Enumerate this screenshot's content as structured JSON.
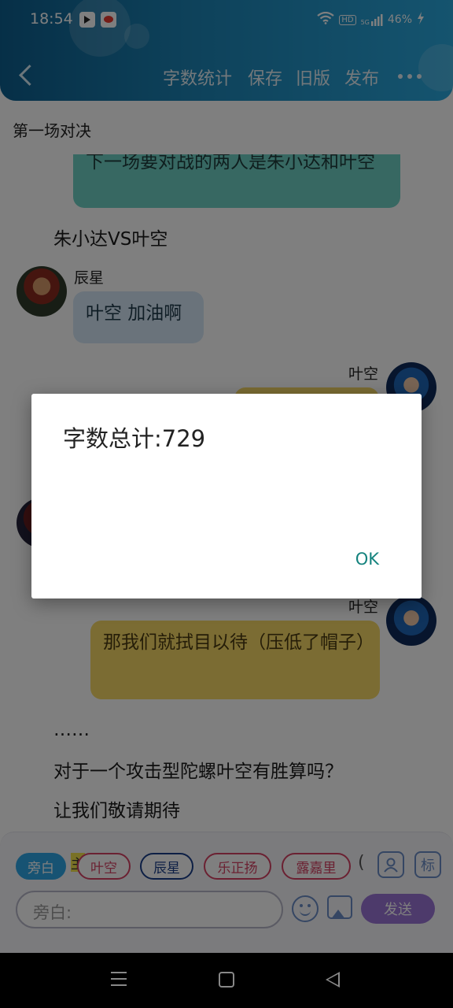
{
  "status_bar": {
    "time": "18:54",
    "network": "5G",
    "hd_label": "HD",
    "battery": "46%"
  },
  "header": {
    "nav": [
      "字数统计",
      "保存",
      "旧版",
      "发布"
    ]
  },
  "scene": {
    "title": "第一场对决"
  },
  "chat": {
    "top_bubble": "下一场要对战的两人是朱小达和叶空",
    "narration_1": "朱小达VS叶空",
    "msg_chenxing": {
      "name": "辰星",
      "text": "叶空 加油啊"
    },
    "msg_yekong_1": {
      "name": "叶空"
    },
    "msg_yekong_2": {
      "name": "叶空",
      "text": "那我们就拭目以待（压低了帽子）"
    },
    "narration_2": "……",
    "narration_3": "对于一个攻击型陀螺叶空有胜算吗？",
    "narration_4": "让我们敬请期待"
  },
  "composer": {
    "roles": [
      {
        "label": "旁白",
        "active": true,
        "color": "#2fa7e7"
      },
      {
        "label": "叶空",
        "active": false,
        "color": "#d64264"
      },
      {
        "label": "辰星",
        "active": false,
        "color": "#1a3f8a"
      },
      {
        "label": "乐正扬",
        "active": false,
        "color": "#d64264"
      },
      {
        "label": "露嘉里",
        "active": false,
        "color": "#d64264"
      }
    ],
    "marker": "主",
    "input_placeholder": "旁白:",
    "send_label": "发送",
    "tag_icon_label": "标"
  },
  "dialog": {
    "message": "字数总计:729",
    "ok_label": "OK"
  },
  "colors": {
    "header_gradient_start": "#0d5f8f",
    "header_gradient_end": "#2aa8de",
    "narrator_bubble": "#6fd0c4",
    "chenxing_bubble": "#d5e7f7",
    "yekong_bubble": "#f6d867",
    "send_button": "#9b75d6",
    "ok_text": "#15837e"
  }
}
